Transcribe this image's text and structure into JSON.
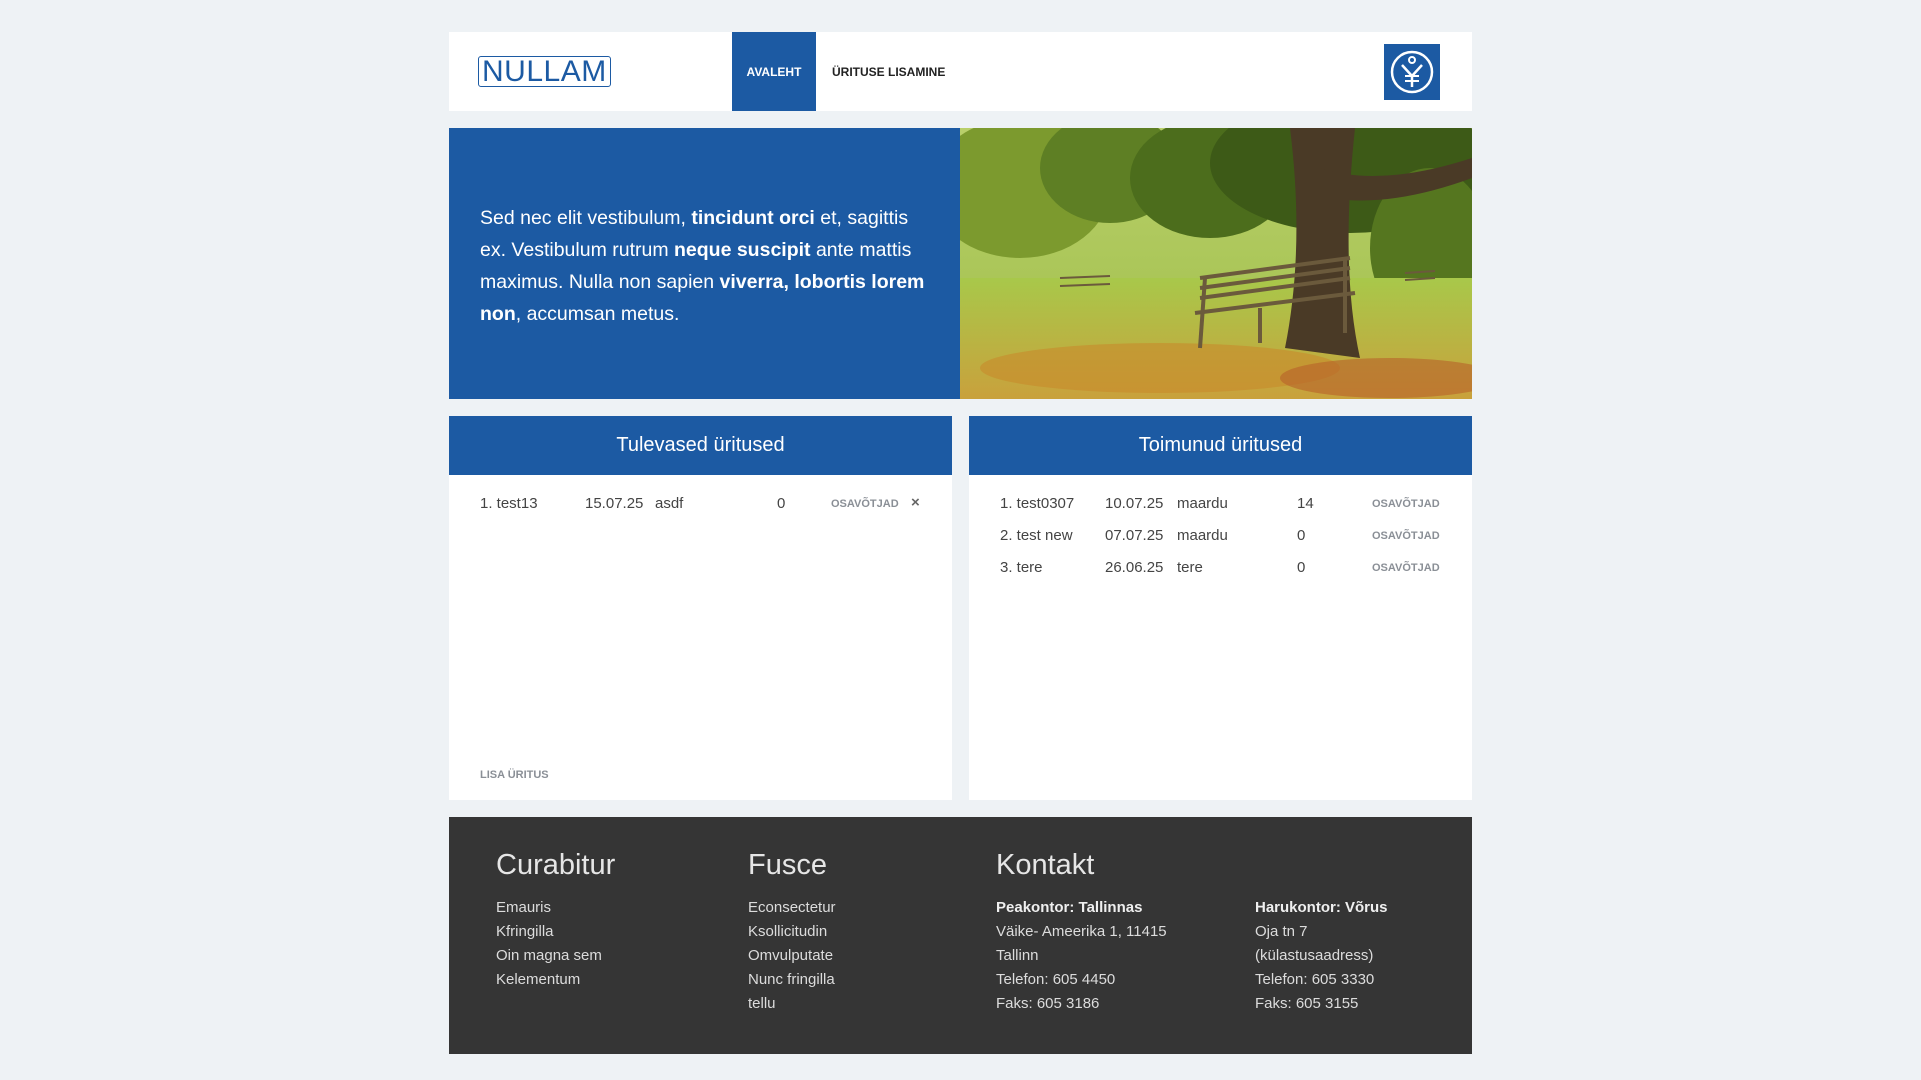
{
  "header": {
    "logo": "NULLAM",
    "nav": [
      {
        "label": "AVALEHT",
        "active": true
      },
      {
        "label": "ÜRITUSE LISAMINE",
        "active": false
      }
    ],
    "emblem_icon": "emblem-logo-icon"
  },
  "hero": {
    "p1": "Sed nec elit vestibulum, ",
    "b1": "tincidunt orci",
    "p2": " et, sagittis ex. Vestibulum rutrum ",
    "b2": "neque suscipit",
    "p3": " ante mattis maximus. Nulla non sapien ",
    "b3": "viverra, lobortis lorem non",
    "p4": ", accumsan metus.",
    "image": "park-bench-under-tree-photo"
  },
  "upcoming": {
    "title": "Tulevased üritused",
    "rows": [
      {
        "name": "1. test13",
        "date": "15.07.25",
        "place": "asdf",
        "count": "0",
        "link": "OSAVÕTJAD",
        "delete": "×"
      }
    ],
    "add_link": "LISA ÜRITUS"
  },
  "past": {
    "title": "Toimunud üritused",
    "rows": [
      {
        "name": "1. test0307",
        "date": "10.07.25",
        "place": "maardu",
        "count": "14",
        "link": "OSAVÕTJAD"
      },
      {
        "name": "2. test new",
        "date": "07.07.25",
        "place": "maardu",
        "count": "0",
        "link": "OSAVÕTJAD"
      },
      {
        "name": "3. tere",
        "date": "26.06.25",
        "place": "tere",
        "count": "0",
        "link": "OSAVÕTJAD"
      }
    ]
  },
  "footer": {
    "col1": {
      "title": "Curabitur",
      "items": [
        "Emauris",
        "Kfringilla",
        "Oin magna sem",
        "Kelementum"
      ]
    },
    "col2": {
      "title": "Fusce",
      "items": [
        "Econsectetur",
        "Ksollicitudin",
        "Omvulputate",
        "Nunc fringilla",
        "tellu"
      ]
    },
    "contact": {
      "title": "Kontakt",
      "main": {
        "heading": "Peakontor: Tallinnas",
        "lines": [
          "Väike- Ameerika 1, 11415",
          "Tallinn",
          "Telefon: 605 4450",
          "Faks: 605 3186"
        ]
      },
      "branch": {
        "heading": "Harukontor: Võrus",
        "lines": [
          "Oja tn 7",
          "(külastusaadress)",
          "Telefon: 605 3330",
          "Faks: 605 3155"
        ]
      }
    }
  },
  "colors": {
    "accent": "#1c5aa3",
    "footer_bg": "#353535",
    "page_bg": "#eef2f5"
  }
}
